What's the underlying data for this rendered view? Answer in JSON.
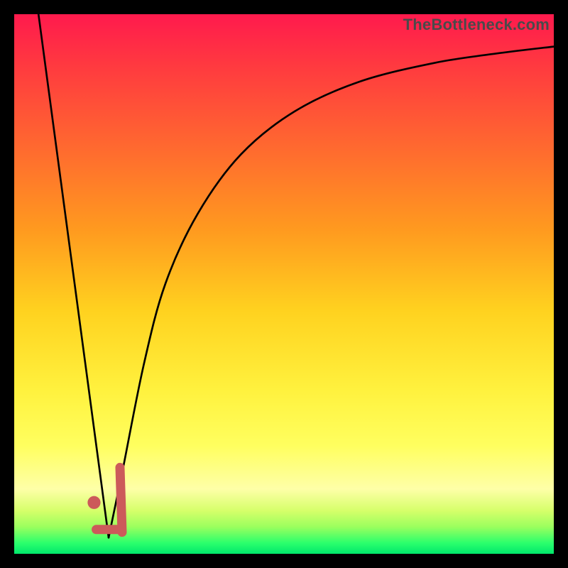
{
  "watermark": "TheBottleneck.com",
  "colors": {
    "curve_stroke": "#000000",
    "marker_stroke": "#cc5a5a",
    "marker_fill": "#cc5a5a",
    "frame": "#000000"
  },
  "chart_data": {
    "type": "line",
    "title": "",
    "xlabel": "",
    "ylabel": "",
    "xlim": [
      0,
      100
    ],
    "ylim": [
      0,
      100
    ],
    "grid": false,
    "series": [
      {
        "name": "bottleneck-curve-left",
        "x": [
          4.5,
          17.5
        ],
        "y": [
          100,
          3
        ],
        "stroke": "#000000"
      },
      {
        "name": "bottleneck-curve-right",
        "x": [
          17.5,
          20,
          24,
          28,
          34,
          42,
          52,
          64,
          78,
          90,
          100
        ],
        "y": [
          3,
          15,
          35,
          50,
          63,
          74,
          82,
          87.5,
          91,
          92.8,
          94
        ],
        "stroke": "#000000"
      }
    ],
    "markers": [
      {
        "name": "j-shape-segment-1",
        "type": "line",
        "x": [
          19.6,
          20.0
        ],
        "y": [
          16,
          4
        ],
        "stroke": "#cc5a5a",
        "width": 13
      },
      {
        "name": "j-shape-segment-2",
        "type": "line",
        "x": [
          19.2,
          15.2
        ],
        "y": [
          4.5,
          4.5
        ],
        "stroke": "#cc5a5a",
        "width": 13
      },
      {
        "name": "dot",
        "type": "point",
        "x": 14.8,
        "y": 9.5,
        "r": 1.2,
        "fill": "#cc5a5a"
      }
    ]
  }
}
